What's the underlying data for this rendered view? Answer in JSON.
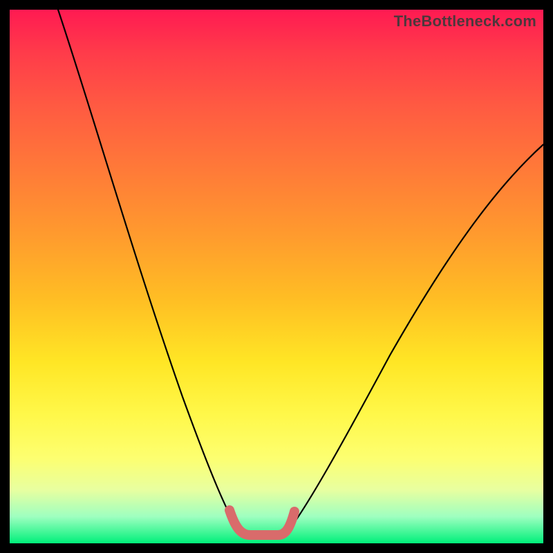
{
  "watermark": {
    "text": "TheBottleneck.com"
  },
  "chart_data": {
    "type": "line",
    "title": "",
    "xlabel": "",
    "ylabel": "",
    "xlim": [
      0,
      100
    ],
    "ylim": [
      0,
      100
    ],
    "grid": false,
    "legend": false,
    "series": [
      {
        "name": "left-curve",
        "x": [
          10,
          14,
          18,
          22,
          26,
          30,
          34,
          37,
          39,
          41,
          42,
          43
        ],
        "values": [
          100,
          88,
          76,
          64,
          52,
          40,
          28,
          18,
          11,
          6,
          3,
          1
        ]
      },
      {
        "name": "right-curve",
        "x": [
          50,
          52,
          55,
          60,
          66,
          73,
          80,
          87,
          94,
          100
        ],
        "values": [
          1,
          3,
          7,
          14,
          23,
          34,
          45,
          56,
          67,
          76
        ]
      },
      {
        "name": "highlight-bottom",
        "x": [
          41,
          43,
          46,
          49,
          51
        ],
        "values": [
          4,
          1,
          0.5,
          1,
          4
        ]
      }
    ],
    "annotations": [
      {
        "text": "TheBottleneck.com",
        "role": "watermark",
        "position": "top-right"
      }
    ]
  }
}
